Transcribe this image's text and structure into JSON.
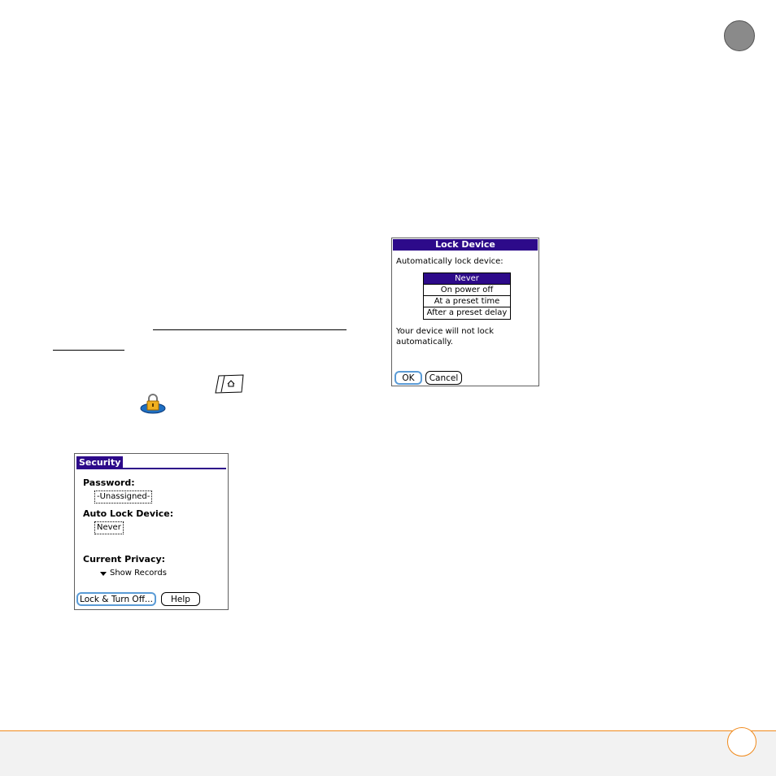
{
  "security_screen": {
    "title": "Security",
    "password_label": "Password:",
    "password_value": "-Unassigned-",
    "auto_lock_label": "Auto Lock Device:",
    "auto_lock_value": "Never",
    "privacy_label": "Current Privacy:",
    "privacy_value": "Show Records",
    "lock_button": "Lock & Turn Off...",
    "help_button": "Help"
  },
  "lock_device_screen": {
    "title": "Lock Device",
    "prompt": "Automatically lock device:",
    "options": [
      "Never",
      "On power off",
      "At a preset time",
      "After a preset delay"
    ],
    "selected_option": "Never",
    "description": "Your device will not lock automatically.",
    "ok_button": "OK",
    "cancel_button": "Cancel"
  },
  "colors": {
    "palm_title_bar": "#2d0a8a",
    "footer_accent": "#f08a1c",
    "chapter_tab": "#8a8a8a"
  },
  "icons": [
    "home-key-icon",
    "security-lock-icon",
    "dropdown-triangle-icon"
  ]
}
